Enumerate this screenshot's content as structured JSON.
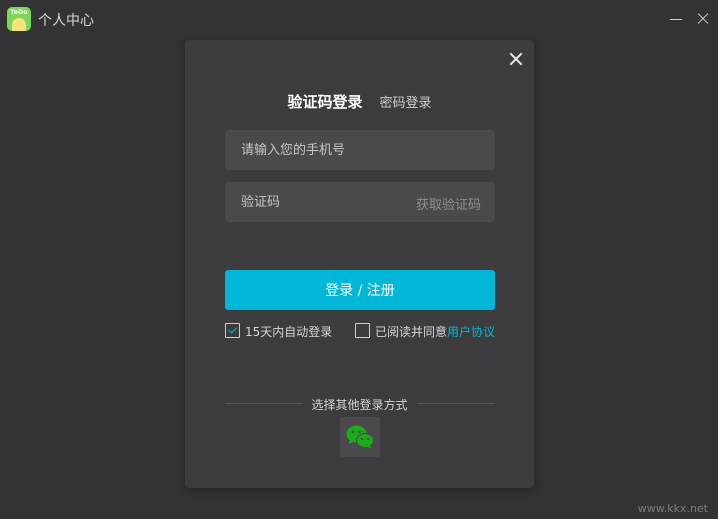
{
  "window": {
    "logo_text": "ToDo",
    "title": "个人中心"
  },
  "dialog": {
    "tabs": {
      "sms_login": "验证码登录",
      "password_login": "密码登录"
    },
    "phone_placeholder": "请输入您的手机号",
    "code_placeholder": "验证码",
    "get_code": "获取验证码",
    "login_button": "登录 / 注册",
    "auto_login": {
      "label": "15天内自动登录",
      "checked": true
    },
    "agreement": {
      "label": "已阅读并同意",
      "link": "用户协议",
      "checked": false
    },
    "other_login_label": "选择其他登录方式",
    "other_login_icon": "wechat-icon"
  },
  "colors": {
    "accent": "#00b7d7",
    "background": "#333336",
    "panel": "#3c3c3f",
    "wechat": "#1aad19"
  },
  "watermark": "www.kkx.net"
}
